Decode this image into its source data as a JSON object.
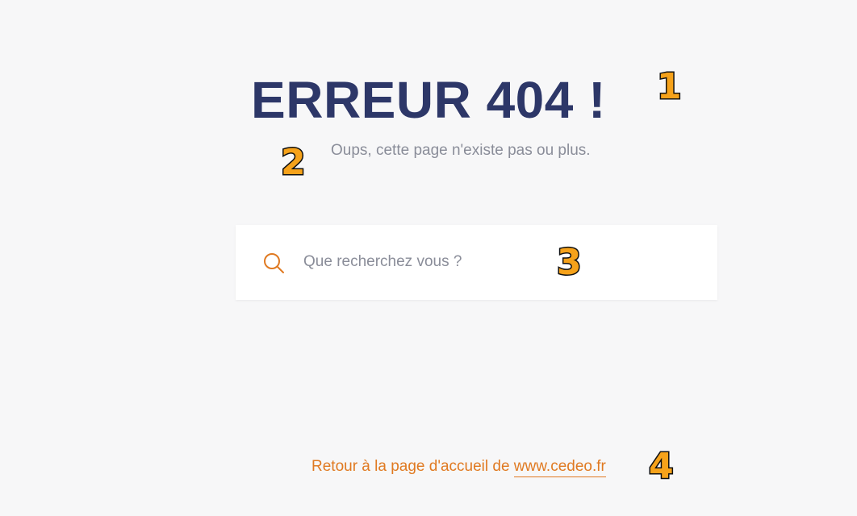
{
  "error": {
    "title": "ERREUR 404 !",
    "subtitle": "Oups, cette page n'existe pas ou plus."
  },
  "search": {
    "placeholder": "Que recherchez vous ?",
    "value": "",
    "icon": "search-icon"
  },
  "footer": {
    "back_text": "Retour à la page d'accueil de ",
    "link_text": "www.cedeo.fr"
  },
  "markers": [
    "1",
    "2",
    "3",
    "4"
  ],
  "colors": {
    "title": "#2d3768",
    "subtitle": "#8a8d99",
    "accent": "#e07a22",
    "marker_fill": "#f6a21a",
    "background": "#f7f7f8"
  }
}
